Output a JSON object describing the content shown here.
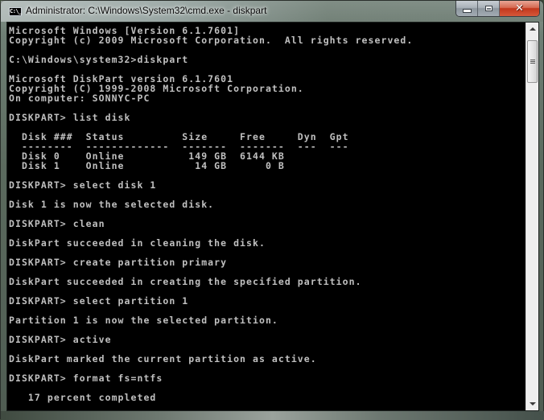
{
  "window": {
    "title": "Administrator: C:\\Windows\\System32\\cmd.exe - diskpart",
    "icon": "cmd-icon",
    "icon_label": "C:\\_",
    "controls": {
      "minimize": "minimize-icon",
      "maximize": "maximize-icon",
      "close": "close-icon",
      "close_glyph": "✕"
    }
  },
  "console": {
    "foreground": "#c0c0c0",
    "background": "#000000",
    "lines": [
      "Microsoft Windows [Version 6.1.7601]",
      "Copyright (c) 2009 Microsoft Corporation.  All rights reserved.",
      "",
      "C:\\Windows\\system32>diskpart",
      "",
      "Microsoft DiskPart version 6.1.7601",
      "Copyright (C) 1999-2008 Microsoft Corporation.",
      "On computer: SONNYC-PC",
      "",
      "DISKPART> list disk",
      "",
      "  Disk ###  Status         Size     Free     Dyn  Gpt",
      "  --------  -------------  -------  -------  ---  ---",
      "  Disk 0    Online          149 GB  6144 KB",
      "  Disk 1    Online           14 GB      0 B",
      "",
      "DISKPART> select disk 1",
      "",
      "Disk 1 is now the selected disk.",
      "",
      "DISKPART> clean",
      "",
      "DiskPart succeeded in cleaning the disk.",
      "",
      "DISKPART> create partition primary",
      "",
      "DiskPart succeeded in creating the specified partition.",
      "",
      "DISKPART> select partition 1",
      "",
      "Partition 1 is now the selected partition.",
      "",
      "DISKPART> active",
      "",
      "DiskPart marked the current partition as active.",
      "",
      "DISKPART> format fs=ntfs",
      "",
      "   17 percent completed"
    ]
  },
  "disk_table": {
    "headers": [
      "Disk ###",
      "Status",
      "Size",
      "Free",
      "Dyn",
      "Gpt"
    ],
    "rows": [
      [
        "Disk 0",
        "Online",
        "149 GB",
        "6144 KB",
        "",
        ""
      ],
      [
        "Disk 1",
        "Online",
        "14 GB",
        "0 B",
        "",
        ""
      ]
    ]
  },
  "format_progress": {
    "percent": 17,
    "label": "17 percent completed"
  },
  "scrollbar": {
    "up": "scroll-up-arrow-icon",
    "down": "scroll-down-arrow-icon",
    "thumb_grip": "grip-icon"
  }
}
